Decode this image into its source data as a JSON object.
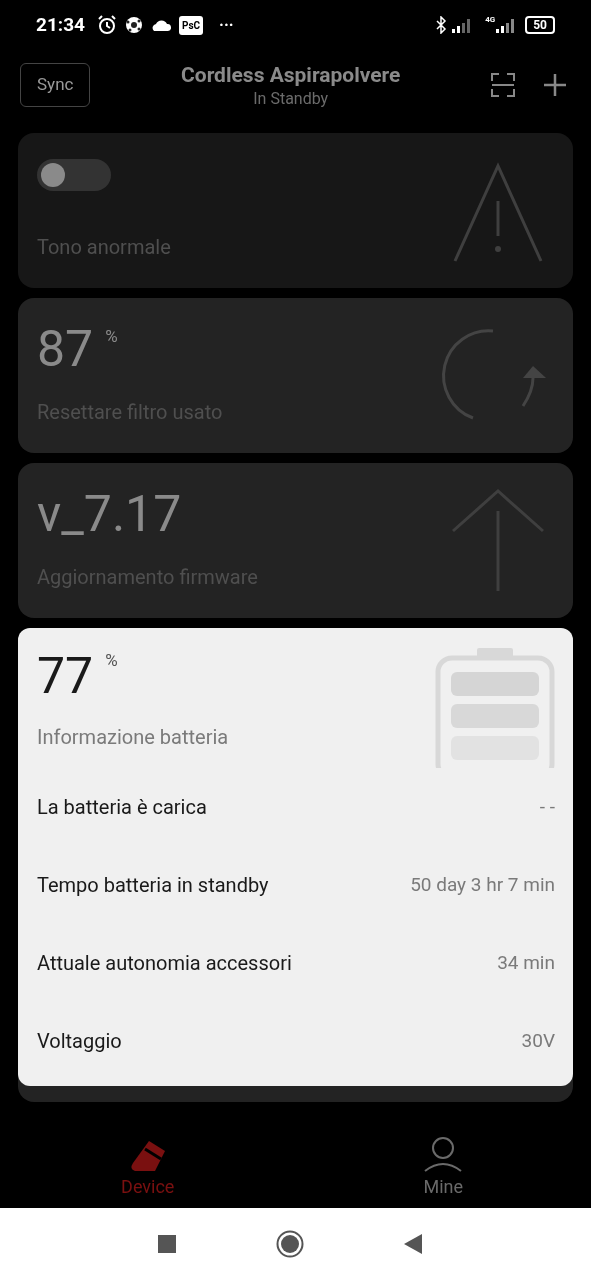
{
  "status_bar": {
    "time": "21:34",
    "app_badge": "PsC",
    "more": "···",
    "network": "4G",
    "battery": "50"
  },
  "header": {
    "sync_button": "Sync",
    "title": "Cordless Aspirapolvere",
    "subtitle": "In Standby"
  },
  "cards": [
    {
      "kind": "toggle",
      "on": false,
      "label": "Tono anormale"
    },
    {
      "kind": "filter",
      "value": "87",
      "unit": "%",
      "label": "Resettare filtro usato"
    },
    {
      "kind": "firmware",
      "value": "v_7.17",
      "label": "Aggiornamento firmware"
    }
  ],
  "battery_card": {
    "value": "77",
    "unit": "%",
    "label": "Informazione batteria",
    "rows": [
      {
        "label": "La batteria è carica",
        "value": "- -"
      },
      {
        "label": "Tempo batteria in standby",
        "value": "50 day 3 hr 7 min"
      },
      {
        "label": "Attuale autonomia accessori",
        "value": "34 min"
      },
      {
        "label": "Voltaggio",
        "value": "30V"
      }
    ]
  },
  "bottom_nav": [
    {
      "label": "Device",
      "selected": true
    },
    {
      "label": "Mine",
      "selected": false
    }
  ]
}
